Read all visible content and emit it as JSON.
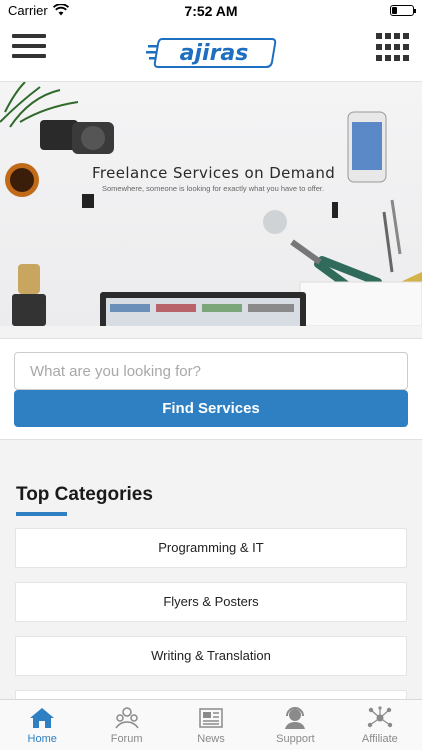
{
  "status_bar": {
    "carrier": "Carrier",
    "time": "7:52 AM"
  },
  "header": {
    "logo_text": "ajiras",
    "menu_icon": "hamburger-menu-icon",
    "grid_icon": "grid-menu-icon"
  },
  "hero": {
    "title": "Freelance Services on Demand",
    "subtitle": "Somewhere, someone is looking for exactly what you have to offer."
  },
  "search": {
    "placeholder": "What are you looking for?",
    "value": "",
    "button_label": "Find Services"
  },
  "categories": {
    "title": "Top Categories",
    "items": [
      {
        "label": "Programming & IT"
      },
      {
        "label": "Flyers & Posters"
      },
      {
        "label": "Writing & Translation"
      },
      {
        "label": ""
      }
    ]
  },
  "tabs": [
    {
      "label": "Home",
      "icon": "home-icon",
      "active": true
    },
    {
      "label": "Forum",
      "icon": "forum-icon",
      "active": false
    },
    {
      "label": "News",
      "icon": "news-icon",
      "active": false
    },
    {
      "label": "Support",
      "icon": "support-icon",
      "active": false
    },
    {
      "label": "Affiliate",
      "icon": "affiliate-icon",
      "active": false
    }
  ],
  "colors": {
    "accent": "#2f80c3",
    "tab_inactive": "#8a8a8a",
    "logo_blue": "#1e6fbf"
  }
}
